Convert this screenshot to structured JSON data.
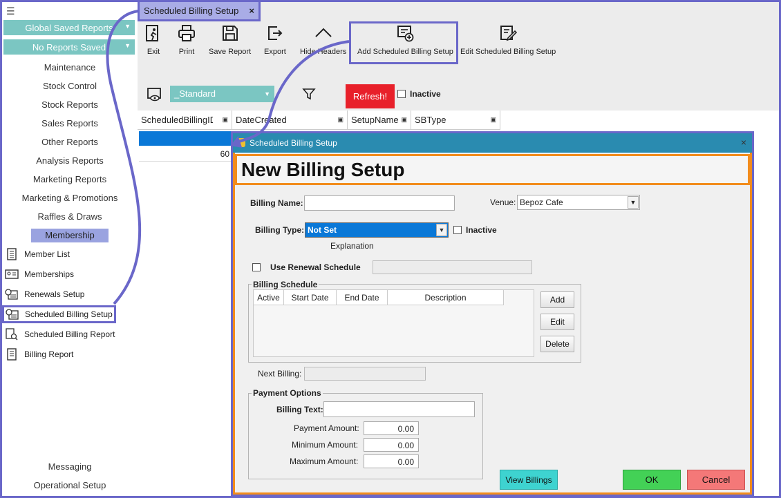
{
  "sidebar": {
    "global_saved_reports": "Global Saved Reports",
    "no_reports_saved": "No Reports Saved",
    "links": [
      "Maintenance",
      "Stock Control",
      "Stock Reports",
      "Sales Reports",
      "Other Reports",
      "Analysis Reports",
      "Marketing Reports",
      "Marketing & Promotions",
      "Raffles & Draws",
      "Membership"
    ],
    "items": [
      "Member List",
      "Memberships",
      "Renewals Setup",
      "Scheduled Billing Setup",
      "Scheduled Billing Report",
      "Billing Report"
    ],
    "bottom_links": [
      "Messaging",
      "Operational Setup"
    ]
  },
  "tab": {
    "label": "Scheduled Billing Setup",
    "close": "×"
  },
  "toolbar": {
    "exit": "Exit",
    "print": "Print",
    "save_report": "Save Report",
    "export": "Export",
    "hide_headers": "Hide Headers",
    "add_scheduled": "Add Scheduled Billing Setup",
    "edit_scheduled": "Edit Scheduled Billing Setup"
  },
  "filter": {
    "view": "_Standard",
    "refresh": "Refresh!",
    "inactive": "Inactive"
  },
  "grid": {
    "columns": [
      "ScheduledBillingID",
      "DateCreated",
      "SetupName",
      "SBType"
    ],
    "row2_value": "60"
  },
  "dialog": {
    "title": "Scheduled Billing Setup",
    "close": "×",
    "header": "New Billing Setup",
    "billing_name_label": "Billing Name:",
    "billing_name_value": "",
    "venue_label": "Venue:",
    "venue_value": "Bepoz Cafe",
    "billing_type_label": "Billing Type:",
    "billing_type_value": "Not Set",
    "inactive_label": "Inactive",
    "explanation": "Explanation",
    "use_renewal_label": "Use Renewal Schedule",
    "billing_schedule_title": "Billing Schedule",
    "schedule_columns": [
      "Active",
      "Start Date",
      "End Date",
      "Description"
    ],
    "add": "Add",
    "edit": "Edit",
    "delete": "Delete",
    "next_billing_label": "Next Billing:",
    "payment_options_title": "Payment Options",
    "billing_text_label": "Billing Text:",
    "payment_amount_label": "Payment Amount:",
    "payment_amount": "0.00",
    "minimum_amount_label": "Minimum Amount:",
    "minimum_amount": "0.00",
    "maximum_amount_label": "Maximum Amount:",
    "maximum_amount": "0.00",
    "view_billings": "View Billings",
    "ok": "OK",
    "cancel": "Cancel"
  },
  "colors": {
    "accent_teal": "#7bc6c2",
    "highlight_purple": "#6a67c9",
    "dialog_orange": "#f28c1c",
    "refresh_red": "#e8202a"
  }
}
